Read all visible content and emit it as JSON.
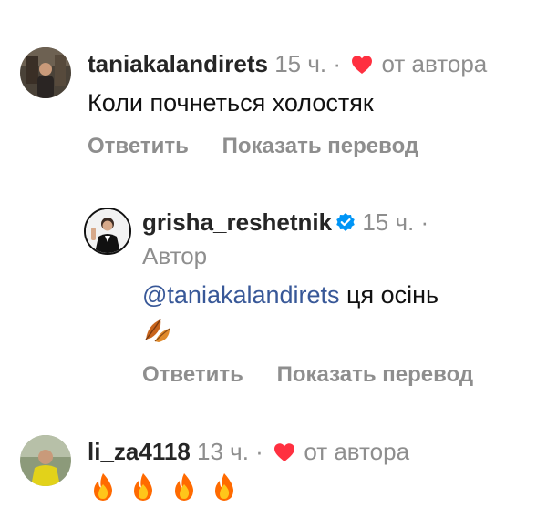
{
  "comments": [
    {
      "username": "taniakalandirets",
      "time": "15 ч.",
      "separator": "·",
      "liked_by_author_label": "от автора",
      "text": "Коли почнеться холостяк",
      "reply_label": "Ответить",
      "translate_label": "Показать перевод"
    },
    {
      "username": "grisha_reshetnik",
      "verified": true,
      "time": "15 ч.",
      "separator": "·",
      "author_label": "Автор",
      "mention": "@taniakalandirets",
      "text": "ця осінь",
      "emoji": "fallen-leaf",
      "reply_label": "Ответить",
      "translate_label": "Показать перевод"
    },
    {
      "username": "li_za4118",
      "time": "13 ч.",
      "separator": "·",
      "liked_by_author_label": "от автора",
      "emoji": [
        "fire",
        "fire",
        "fire",
        "fire"
      ]
    }
  ],
  "colors": {
    "heart": "#ff3040",
    "verified": "#0095f6",
    "mention": "#385898",
    "secondary_text": "#8e8e8e"
  }
}
